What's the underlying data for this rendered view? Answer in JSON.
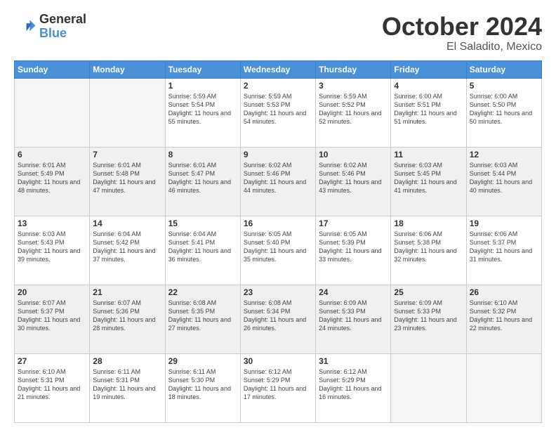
{
  "header": {
    "logo_general": "General",
    "logo_blue": "Blue",
    "title": "October 2024",
    "subtitle": "El Saladito, Mexico"
  },
  "days_of_week": [
    "Sunday",
    "Monday",
    "Tuesday",
    "Wednesday",
    "Thursday",
    "Friday",
    "Saturday"
  ],
  "weeks": [
    [
      {
        "day": "",
        "empty": true
      },
      {
        "day": "",
        "empty": true
      },
      {
        "day": "1",
        "sunrise": "Sunrise: 5:59 AM",
        "sunset": "Sunset: 5:54 PM",
        "daylight": "Daylight: 11 hours and 55 minutes."
      },
      {
        "day": "2",
        "sunrise": "Sunrise: 5:59 AM",
        "sunset": "Sunset: 5:53 PM",
        "daylight": "Daylight: 11 hours and 54 minutes."
      },
      {
        "day": "3",
        "sunrise": "Sunrise: 5:59 AM",
        "sunset": "Sunset: 5:52 PM",
        "daylight": "Daylight: 11 hours and 52 minutes."
      },
      {
        "day": "4",
        "sunrise": "Sunrise: 6:00 AM",
        "sunset": "Sunset: 5:51 PM",
        "daylight": "Daylight: 11 hours and 51 minutes."
      },
      {
        "day": "5",
        "sunrise": "Sunrise: 6:00 AM",
        "sunset": "Sunset: 5:50 PM",
        "daylight": "Daylight: 11 hours and 50 minutes."
      }
    ],
    [
      {
        "day": "6",
        "sunrise": "Sunrise: 6:01 AM",
        "sunset": "Sunset: 5:49 PM",
        "daylight": "Daylight: 11 hours and 48 minutes."
      },
      {
        "day": "7",
        "sunrise": "Sunrise: 6:01 AM",
        "sunset": "Sunset: 5:48 PM",
        "daylight": "Daylight: 11 hours and 47 minutes."
      },
      {
        "day": "8",
        "sunrise": "Sunrise: 6:01 AM",
        "sunset": "Sunset: 5:47 PM",
        "daylight": "Daylight: 11 hours and 46 minutes."
      },
      {
        "day": "9",
        "sunrise": "Sunrise: 6:02 AM",
        "sunset": "Sunset: 5:46 PM",
        "daylight": "Daylight: 11 hours and 44 minutes."
      },
      {
        "day": "10",
        "sunrise": "Sunrise: 6:02 AM",
        "sunset": "Sunset: 5:46 PM",
        "daylight": "Daylight: 11 hours and 43 minutes."
      },
      {
        "day": "11",
        "sunrise": "Sunrise: 6:03 AM",
        "sunset": "Sunset: 5:45 PM",
        "daylight": "Daylight: 11 hours and 41 minutes."
      },
      {
        "day": "12",
        "sunrise": "Sunrise: 6:03 AM",
        "sunset": "Sunset: 5:44 PM",
        "daylight": "Daylight: 11 hours and 40 minutes."
      }
    ],
    [
      {
        "day": "13",
        "sunrise": "Sunrise: 6:03 AM",
        "sunset": "Sunset: 5:43 PM",
        "daylight": "Daylight: 11 hours and 39 minutes."
      },
      {
        "day": "14",
        "sunrise": "Sunrise: 6:04 AM",
        "sunset": "Sunset: 5:42 PM",
        "daylight": "Daylight: 11 hours and 37 minutes."
      },
      {
        "day": "15",
        "sunrise": "Sunrise: 6:04 AM",
        "sunset": "Sunset: 5:41 PM",
        "daylight": "Daylight: 11 hours and 36 minutes."
      },
      {
        "day": "16",
        "sunrise": "Sunrise: 6:05 AM",
        "sunset": "Sunset: 5:40 PM",
        "daylight": "Daylight: 11 hours and 35 minutes."
      },
      {
        "day": "17",
        "sunrise": "Sunrise: 6:05 AM",
        "sunset": "Sunset: 5:39 PM",
        "daylight": "Daylight: 11 hours and 33 minutes."
      },
      {
        "day": "18",
        "sunrise": "Sunrise: 6:06 AM",
        "sunset": "Sunset: 5:38 PM",
        "daylight": "Daylight: 11 hours and 32 minutes."
      },
      {
        "day": "19",
        "sunrise": "Sunrise: 6:06 AM",
        "sunset": "Sunset: 5:37 PM",
        "daylight": "Daylight: 11 hours and 31 minutes."
      }
    ],
    [
      {
        "day": "20",
        "sunrise": "Sunrise: 6:07 AM",
        "sunset": "Sunset: 5:37 PM",
        "daylight": "Daylight: 11 hours and 30 minutes."
      },
      {
        "day": "21",
        "sunrise": "Sunrise: 6:07 AM",
        "sunset": "Sunset: 5:36 PM",
        "daylight": "Daylight: 11 hours and 28 minutes."
      },
      {
        "day": "22",
        "sunrise": "Sunrise: 6:08 AM",
        "sunset": "Sunset: 5:35 PM",
        "daylight": "Daylight: 11 hours and 27 minutes."
      },
      {
        "day": "23",
        "sunrise": "Sunrise: 6:08 AM",
        "sunset": "Sunset: 5:34 PM",
        "daylight": "Daylight: 11 hours and 26 minutes."
      },
      {
        "day": "24",
        "sunrise": "Sunrise: 6:09 AM",
        "sunset": "Sunset: 5:33 PM",
        "daylight": "Daylight: 11 hours and 24 minutes."
      },
      {
        "day": "25",
        "sunrise": "Sunrise: 6:09 AM",
        "sunset": "Sunset: 5:33 PM",
        "daylight": "Daylight: 11 hours and 23 minutes."
      },
      {
        "day": "26",
        "sunrise": "Sunrise: 6:10 AM",
        "sunset": "Sunset: 5:32 PM",
        "daylight": "Daylight: 11 hours and 22 minutes."
      }
    ],
    [
      {
        "day": "27",
        "sunrise": "Sunrise: 6:10 AM",
        "sunset": "Sunset: 5:31 PM",
        "daylight": "Daylight: 11 hours and 21 minutes."
      },
      {
        "day": "28",
        "sunrise": "Sunrise: 6:11 AM",
        "sunset": "Sunset: 5:31 PM",
        "daylight": "Daylight: 11 hours and 19 minutes."
      },
      {
        "day": "29",
        "sunrise": "Sunrise: 6:11 AM",
        "sunset": "Sunset: 5:30 PM",
        "daylight": "Daylight: 11 hours and 18 minutes."
      },
      {
        "day": "30",
        "sunrise": "Sunrise: 6:12 AM",
        "sunset": "Sunset: 5:29 PM",
        "daylight": "Daylight: 11 hours and 17 minutes."
      },
      {
        "day": "31",
        "sunrise": "Sunrise: 6:12 AM",
        "sunset": "Sunset: 5:29 PM",
        "daylight": "Daylight: 11 hours and 16 minutes."
      },
      {
        "day": "",
        "empty": true
      },
      {
        "day": "",
        "empty": true
      }
    ]
  ]
}
